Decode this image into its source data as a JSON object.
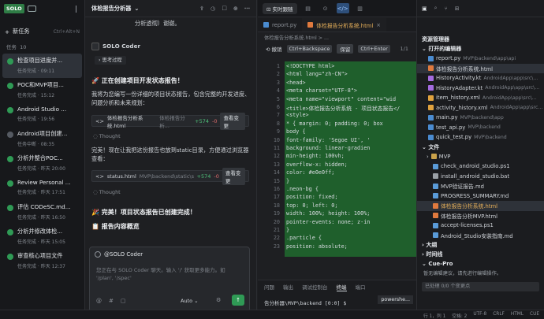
{
  "left": {
    "logo": "SOLO",
    "new_task": "新任务",
    "new_task_shortcut": "Ctrl+Alt+N",
    "tasks_label": "任务",
    "tasks_count": "10",
    "tasks": [
      {
        "title": "检查项目进度并...",
        "status": "任务完成 · 09:11",
        "selected": true,
        "gray": false
      },
      {
        "title": "POC和MVP项目...",
        "status": "任务完成 · 15:12",
        "gray": false
      },
      {
        "title": "Android Studio ...",
        "status": "任务完成 · 19:56",
        "gray": false
      },
      {
        "title": "Android项目创建...",
        "status": "任务中断 · 08:35",
        "gray": true
      },
      {
        "title": "分析并整合POC...",
        "status": "任务完成 · 昨天 20:00",
        "gray": false
      },
      {
        "title": "Review Personal ...",
        "status": "任务完成 · 昨天 17:51",
        "gray": false
      },
      {
        "title": "评估 CODeSC.md...",
        "status": "任务完成 · 昨天 16:50",
        "gray": false
      },
      {
        "title": "分析并修改体检...",
        "status": "任务完成 · 昨天 15:05",
        "gray": false
      },
      {
        "title": "审查核心项目文件",
        "status": "任务完成 · 昨天 12:37",
        "gray": false
      }
    ]
  },
  "chat": {
    "title": "体检报告分析器",
    "top_line": "分析透彻）谢谢。",
    "agent": "SOLO Coder",
    "thinking": "思考过程",
    "heading1": "🚀 正在创建项目开发状态报告！",
    "p1": "我将为您编写一份详细的项目状态报告，包含完整的开发进度、问题分析和未来规划：",
    "file1": {
      "name": "体检报告分析系统.html",
      "path": "体检报告分析...",
      "add": "+574",
      "del": "-0",
      "btn": "查看变更"
    },
    "thought": "Thought",
    "p2": "完美！现在让我把这份报告也放到static目录，方便通过浏览器查看：",
    "file2": {
      "name": "status.html",
      "path": "MVP\\backend\\static\\stat...",
      "add": "+574",
      "del": "-0",
      "btn": "查看变更"
    },
    "thought2": "Thought",
    "heading2": "🎉 完美！项目状态报告已创建完成！",
    "heading3": "📋 报告内容概览",
    "input_mention": "@SOLO Coder",
    "input_placeholder": "您正在与 SOLO Coder 聊天。输入 '/' 获取更多能力。如 '/plan', '/spec'",
    "mode": "Auto"
  },
  "editor": {
    "preview_label": "实时跟随",
    "tabs": [
      {
        "label": "report.py",
        "active": false
      },
      {
        "label": "体检报告分析系统.html",
        "active": true
      }
    ],
    "breadcrumb": "体检报告分析系统.html > ...",
    "diff": {
      "undo": "撤销",
      "undo_key": "Ctrl+Backspace",
      "keep": "保留",
      "keep_key": "Ctrl+Enter",
      "page": "1/1"
    },
    "lines": [
      "<!DOCTYPE html>",
      "<html lang=\"zh-CN\">",
      "<head>",
      "    <meta charset=\"UTF-8\">",
      "    <meta name=\"viewport\" content=\"wid",
      "    <title>体检报告分析系统 - 项目状态报告</",
      "    <style>",
      "        * { margin: 0; padding: 0; box",
      "        body {",
      "            font-family: 'Segoe UI', '",
      "            background: linear-gradien",
      "            min-height: 100vh;",
      "            overflow-x: hidden;",
      "            color: #e0e0ff;",
      "        }",
      "        .neon-bg {",
      "            position: fixed;",
      "            top: 0; left: 0;",
      "            width: 100%; height: 100%;",
      "            pointer-events: none; z-in",
      "        }",
      "        .particle {",
      "            position: absolute;"
    ],
    "terminal_tabs": [
      "问题",
      "输出",
      "调试控制台",
      "终端",
      "端口"
    ],
    "terminal_active": "终端",
    "terminal_prompt": "告分析器\\MVP\\backend [0:0] $",
    "terminal_shell": "powershe..."
  },
  "explorer": {
    "title": "资源管理器",
    "open_editors": "打开的编辑器",
    "open_files": [
      {
        "name": "report.py",
        "path": "MVP\\backend\\app\\api",
        "color": "#4a8bd0"
      },
      {
        "name": "体检报告分析系统.html",
        "path": "",
        "color": "#e07a3e",
        "selected": true
      },
      {
        "name": "HistoryActivity.kt",
        "path": "AndroidApp\\app\\src\\...",
        "color": "#a46be0"
      },
      {
        "name": "HistoryAdapter.kt",
        "path": "AndroidApp\\app\\src\\...",
        "color": "#a46be0"
      },
      {
        "name": "item_history.xml",
        "path": "AndroidApp\\app\\src\\...",
        "color": "#e0a23e"
      },
      {
        "name": "activity_history.xml",
        "path": "AndroidApp\\app\\src...",
        "color": "#e0a23e"
      },
      {
        "name": "main.py",
        "path": "MVP\\backend\\app",
        "color": "#4a8bd0"
      },
      {
        "name": "test_api.py",
        "path": "MVP\\backend",
        "color": "#4a8bd0"
      },
      {
        "name": "quick_test.py",
        "path": "MVP\\backend",
        "color": "#4a8bd0"
      }
    ],
    "files_label": "文件",
    "mvp_folder": "MVP",
    "tree": [
      {
        "name": "check_android_studio.ps1",
        "color": "#5a9bd8"
      },
      {
        "name": "install_android_studio.bat",
        "color": "#9aa0a6"
      },
      {
        "name": "MVP验证报告.md",
        "color": "#5a9bd8"
      },
      {
        "name": "PROGRESS_SUMMARY.md",
        "color": "#5a9bd8"
      },
      {
        "name": "体检报告分析系统.html",
        "color": "#e07a3e",
        "highlight": true
      },
      {
        "name": "体检报告分析MVP.html",
        "color": "#e07a3e"
      },
      {
        "name": "accept-licenses.ps1",
        "color": "#5a9bd8"
      },
      {
        "name": "Android_Studio安装指南.md",
        "color": "#5a9bd8"
      }
    ],
    "outline": "大纲",
    "timeline": "时间线",
    "cuepro": "Cue-Pro",
    "cuepro_text": "暂无编辑建议，请先进行编辑操作。",
    "changes": "已处理 0/0 个变更点"
  },
  "status": {
    "pos": "行 1，列 1",
    "spaces": "空格: 2",
    "enc": "UTF-8",
    "eol": "CRLF",
    "lang": "HTML",
    "extra": "CUE"
  }
}
